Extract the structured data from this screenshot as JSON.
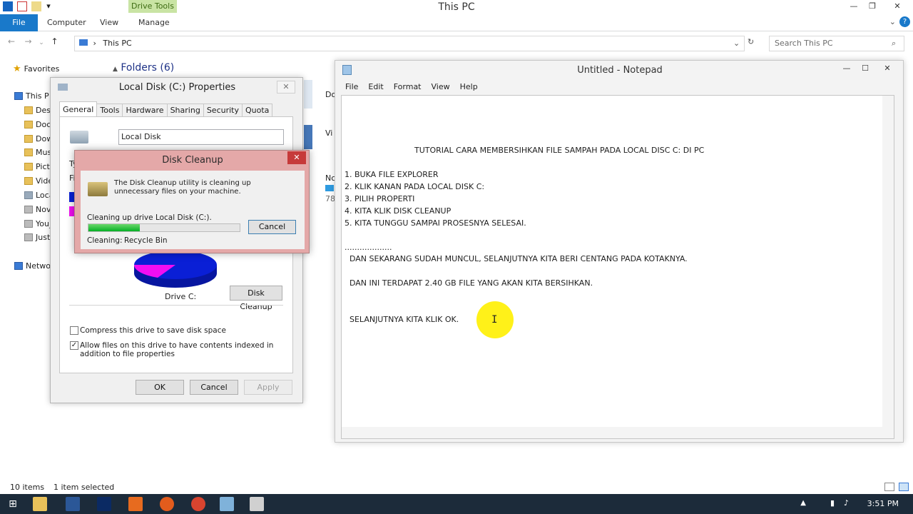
{
  "explorer": {
    "title": "This PC",
    "drive_tools": "Drive Tools",
    "tabs": [
      "File",
      "Computer",
      "View",
      "Manage"
    ],
    "address_path": "This PC",
    "search_placeholder": "Search This PC",
    "favorites": "Favorites",
    "folders_heading": "Folders (6)",
    "nav_items": [
      "This P",
      "Desk",
      "Docu",
      "Dow",
      "Mus",
      "Pictu",
      "Vide",
      "Loca",
      "Nov",
      "You_",
      "Justi",
      "Netwo"
    ],
    "partial_right": [
      "Do",
      "Vi",
      "Nc",
      "78"
    ],
    "status_items": "10 items",
    "status_selected": "1 item selected"
  },
  "properties": {
    "title": "Local Disk (C:) Properties",
    "tabs": [
      "General",
      "Tools",
      "Hardware",
      "Sharing",
      "Security",
      "Quota"
    ],
    "name_value": "Local Disk",
    "partial_labels": [
      "Ty",
      "Fi"
    ],
    "drive_label": "Drive C:",
    "disk_cleanup_button": "Disk Cleanup",
    "compress_label": "Compress this drive to save disk space",
    "compress_checked": false,
    "index_label": "Allow files on this drive to have contents indexed in addition to file properties",
    "index_checked": true,
    "ok": "OK",
    "cancel": "Cancel",
    "apply": "Apply"
  },
  "disk_cleanup": {
    "title": "Disk Cleanup",
    "message": "The Disk Cleanup utility is cleaning up unnecessary files on your machine.",
    "status": "Cleaning up drive Local Disk (C:).",
    "cleaning_label": "Cleaning:",
    "cleaning_value": "Recycle Bin",
    "cancel": "Cancel",
    "progress": 0.34
  },
  "notepad": {
    "title": "Untitled - Notepad",
    "menu": [
      "File",
      "Edit",
      "Format",
      "View",
      "Help"
    ],
    "lines": [
      "TUTORIAL CARA MEMBERSIHKAN FILE SAMPAH PADA LOCAL DISC C: DI PC",
      "1. BUKA FILE EXPLORER",
      "2. KLIK KANAN PADA LOCAL DISK C:",
      "3. PILIH PROPERTI",
      "4. KITA KLIK DISK CLEANUP",
      "5. KITA TUNGGU SAMPAI PROSESNYA SELESAI.",
      "...................",
      "DAN SEKARANG SUDAH MUNCUL, SELANJUTNYA KITA BERI CENTANG PADA KOTAKNYA.",
      "DAN INI TERDAPAT 2.40 GB FILE YANG AKAN KITA BERSIHKAN.",
      "SELANJUTNYA KITA KLIK OK."
    ]
  },
  "taskbar": {
    "clock": "3:51 PM"
  },
  "colors": {
    "file_tab": "#1979ca",
    "drive_tools_bg": "#c9e4a4",
    "taskbar": "#1c2b3a",
    "progress": "#06b025",
    "pie_used": "#0a1fd6",
    "pie_free": "#f20ef2"
  }
}
